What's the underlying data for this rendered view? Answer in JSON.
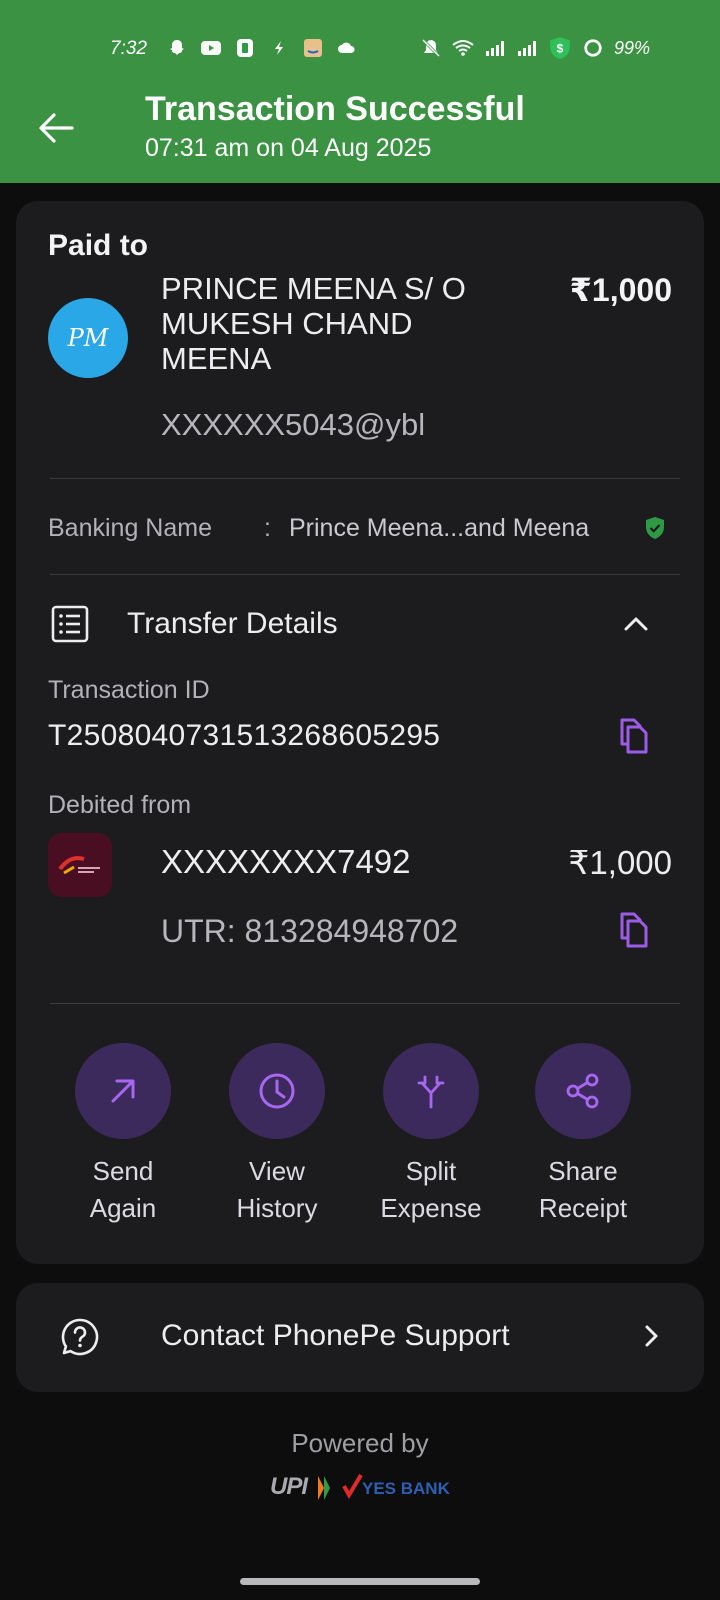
{
  "status_bar": {
    "time": "7:32",
    "battery": "99%"
  },
  "header": {
    "title": "Transaction Successful",
    "subtitle": "07:31 am on 04 Aug 2025",
    "bg_color": "#3a9242"
  },
  "payee": {
    "section_label": "Paid to",
    "avatar_initials": "PM",
    "name": "PRINCE MEENA S/ O MUKESH CHAND MEENA",
    "vpa": "XXXXXX5043@ybl",
    "amount": "₹1,000"
  },
  "banking": {
    "label": "Banking Name",
    "separator": ":",
    "value": "Prince Meena...and Meena",
    "verified_icon": "verified-shield-icon"
  },
  "transfer_details": {
    "title": "Transfer Details",
    "transaction_id_label": "Transaction ID",
    "transaction_id": "T2508040731513268605295",
    "debited_from_label": "Debited from",
    "account_number": "XXXXXXXX7492",
    "account_amount": "₹1,000",
    "utr": "UTR: 813284948702"
  },
  "actions": [
    {
      "label": "Send Again",
      "icon": "arrow-up-right-icon"
    },
    {
      "label": "View History",
      "icon": "clock-icon"
    },
    {
      "label": "Split Expense",
      "icon": "split-icon"
    },
    {
      "label": "Share Receipt",
      "icon": "share-icon"
    }
  ],
  "support": {
    "label": "Contact PhonePe Support"
  },
  "footer": {
    "powered_by": "Powered by",
    "partner_logos": "UPI YES BANK"
  },
  "colors": {
    "accent_purple": "#9d5ce8",
    "verified_green": "#2e9a45"
  }
}
